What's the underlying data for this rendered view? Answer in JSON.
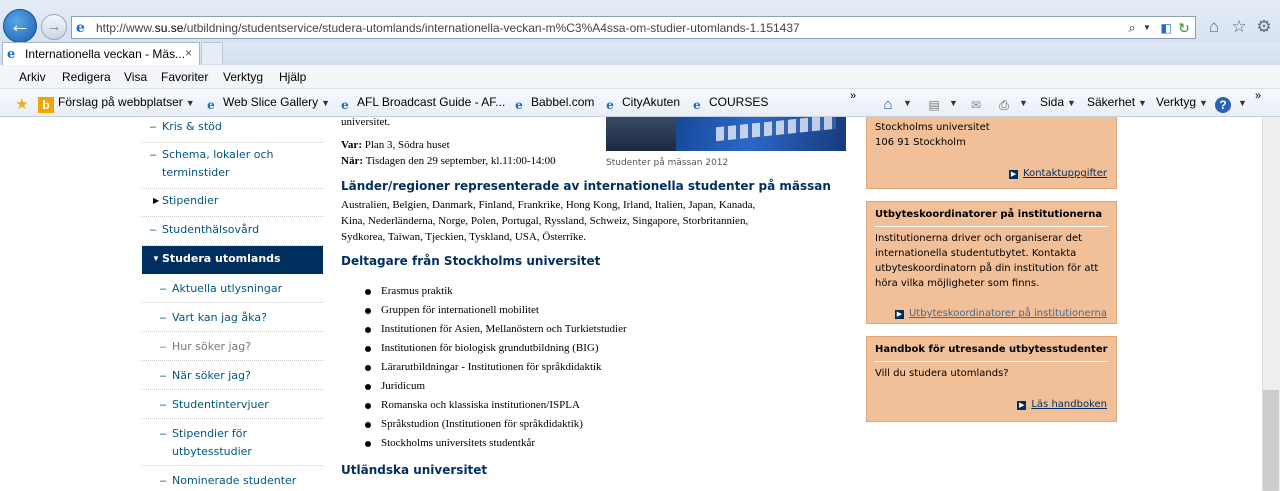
{
  "browser": {
    "url_prefix": "http://www.",
    "url_domain": "su.se",
    "url_path": "/utbildning/studentservice/studera-utomlands/internationella-veckan-m%C3%A4ssa-om-studier-utomlands-1.151437",
    "tab_title": "Internationella veckan - Mäs...",
    "tab_close": "×",
    "back_glyph": "←",
    "forward_glyph": "→",
    "icons": [
      "back-arrow-icon",
      "forward-arrow-icon",
      "search-icon",
      "compatibility-icon",
      "refresh-icon",
      "home-icon",
      "star-icon",
      "gear-icon"
    ]
  },
  "menu": [
    "Arkiv",
    "Redigera",
    "Visa",
    "Favoriter",
    "Verktyg",
    "Hjälp"
  ],
  "favorites": {
    "items": [
      {
        "label": "Förslag på webbplatser",
        "icon": "bing-icon"
      },
      {
        "label": "Web Slice Gallery",
        "icon": "ie-page-icon"
      },
      {
        "label": "AFL Broadcast Guide - AF...",
        "icon": "ie-page-icon"
      },
      {
        "label": "Babbel.com",
        "icon": "ie-page-icon"
      },
      {
        "label": "CityAkuten",
        "icon": "ie-page-icon"
      },
      {
        "label": "COURSES",
        "icon": "ie-page-icon"
      }
    ],
    "overflow": "»",
    "commands": [
      "Sida",
      "Säkerhet",
      "Verktyg"
    ],
    "command_overflow": "»"
  },
  "leftnav": {
    "items": [
      {
        "label": "Kris & stöd",
        "level": 1
      },
      {
        "label": "Schema, lokaler och terminstider",
        "level": 1
      },
      {
        "label": "Stipendier",
        "level": 1
      },
      {
        "label": "Studenthälsovård",
        "level": 1
      },
      {
        "label": "Studera utomlands",
        "level": 1
      },
      {
        "label": "Aktuella utlysningar",
        "level": 2
      },
      {
        "label": "Vart kan jag åka?",
        "level": 2
      },
      {
        "label": "Hur söker jag?",
        "level": 2
      },
      {
        "label": "När söker jag?",
        "level": 2
      },
      {
        "label": "Studentintervjuer",
        "level": 2
      },
      {
        "label": "Stipendier för utbytesstudier",
        "level": 2
      },
      {
        "label": "Nominerade studenter",
        "level": 2
      }
    ]
  },
  "content": {
    "top_fragment": "universitet.",
    "var_label": "Var:",
    "var_value": "Plan 3, Södra huset",
    "nar_label": "När:",
    "nar_value": "Tisdagen den 29 september, kl.11:00-14:00",
    "photo_caption": "Studenter på mässan 2012",
    "heading_countries": "Länder/regioner representerade av internationella studenter på mässan",
    "countries_line1": "Australien, Belgien, Danmark, Finland, Frankrike, Hong Kong, Irland, Italien, Japan, Kanada,",
    "countries_line2": "Kina, Nederländerna, Norge, Polen, Portugal, Ryssland, Schweiz, Singapore, Storbritannien,",
    "countries_line3": "Sydkorea, Taiwan, Tjeckien, Tyskland, USA, Österrike.",
    "heading_participants": "Deltagare från Stockholms universitet",
    "participants": [
      "Erasmus praktik",
      "Gruppen för internationell mobilitet",
      "Institutionen för Asien, Mellanöstern och Turkietstudier",
      "Institutionen för biologisk grundutbildning (BIG)",
      "Lärarutbildningar - Institutionen för språkdidaktik",
      "Juridicum",
      "Romanska och klassiska institutionen/ISPLA",
      "Språkstudion (Institutionen för språkdidaktik)",
      "Stockholms universitets studentkår"
    ],
    "heading_foreign": "Utländska universitet"
  },
  "sidebar": {
    "contact": {
      "line1": "Stockholms universitet",
      "line2": "106 91 Stockholm",
      "link": "Kontaktuppgifter"
    },
    "coordinators": {
      "title": "Utbyteskoordinatorer på institutionerna",
      "line1": "Institutionerna driver och organiserar det",
      "line2": "internationella studentutbytet. Kontakta",
      "line3": "utbyteskoordinatorn på din institution för att",
      "line4": "höra vilka möjligheter som finns.",
      "link": "Utbyteskoordinatorer på institutionerna"
    },
    "handbook": {
      "title": "Handbok för utresande utbytesstudenter",
      "line1": "Vill du studera utomlands?",
      "link": "Läs handboken"
    }
  },
  "colors": {
    "nav_active_bg": "#002f5f",
    "link": "#00567c",
    "heading": "#002f5f",
    "sidebar_box": "#f1bf98"
  }
}
